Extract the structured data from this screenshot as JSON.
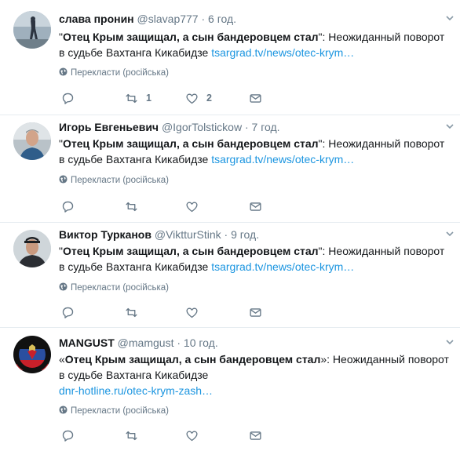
{
  "tweets": [
    {
      "name": "слава пронин",
      "handle": "@slavap777",
      "dot": "·",
      "time": "6 год.",
      "text_open": "\"",
      "text_bold": "Отец Крым защищал, а сын бандеровцем стал",
      "text_close": "\": Неожиданный поворот в судьбе Вахтанга Кикабидзе ",
      "link": "tsargrad.tv/news/otec-krym…",
      "translate": "Перекласти (російська)",
      "retweets": "1",
      "likes": "2"
    },
    {
      "name": "Игорь Евгеньевич",
      "handle": "@IgorTolstickow",
      "dot": "·",
      "time": "7 год.",
      "text_open": "\"",
      "text_bold": "Отец Крым защищал, а сын бандеровцем стал",
      "text_close": "\": Неожиданный поворот в судьбе Вахтанга Кикабидзе ",
      "link": "tsargrad.tv/news/otec-krym…",
      "translate": "Перекласти (російська)",
      "retweets": "",
      "likes": ""
    },
    {
      "name": "Виктор Турканов",
      "handle": "@ViktturStink",
      "dot": "·",
      "time": "9 год.",
      "text_open": "\"",
      "text_bold": "Отец Крым защищал, а сын бандеровцем стал",
      "text_close": "\": Неожиданный поворот в судьбе Вахтанга Кикабидзе ",
      "link": "tsargrad.tv/news/otec-krym…",
      "translate": "Перекласти (російська)",
      "retweets": "",
      "likes": ""
    },
    {
      "name": "MANGUST",
      "handle": "@mamgust",
      "dot": "·",
      "time": "10 год.",
      "text_open": "«",
      "text_bold": "Отец Крым защищал, а сын бандеровцем стал",
      "text_close": "»: Неожиданный поворот в судьбе Вахтанга Кикабидзе",
      "link": "dnr-hotline.ru/otec-krym-zash…",
      "translate": "Перекласти (російська)",
      "retweets": "",
      "likes": ""
    }
  ],
  "icons": {
    "reply": "reply-icon",
    "retweet": "retweet-icon",
    "like": "like-icon",
    "message": "direct-message-icon",
    "globe": "globe-icon",
    "caret": "chevron-down-icon"
  }
}
